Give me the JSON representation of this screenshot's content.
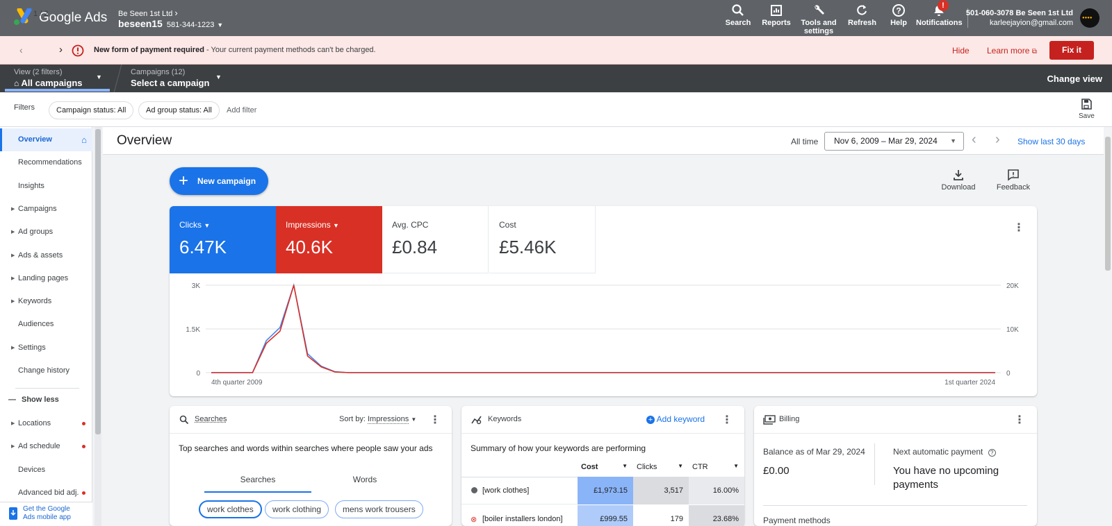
{
  "app": {
    "brand": "Google Ads",
    "account_parent": "Be Seen 1st Ltd",
    "account_name": "beseen15",
    "account_id": "581-344-1223"
  },
  "topnav": {
    "search": "Search",
    "reports": "Reports",
    "tools_line1": "Tools and",
    "tools_line2": "settings",
    "refresh": "Refresh",
    "help": "Help",
    "notifications": "Notifications",
    "notif_badge": "!",
    "user_account": "501-060-3078 Be Seen 1st Ltd",
    "user_email": "karleejayion@gmail.com"
  },
  "alert": {
    "pager": "1 / 2",
    "title": "New form of payment required",
    "message": " - Your current payment methods can't be charged.",
    "hide": "Hide",
    "learn_more": "Learn more",
    "fix_it": "Fix it"
  },
  "viewbar": {
    "view_sub": "View (2 filters)",
    "view_main": "All campaigns",
    "campaigns_sub": "Campaigns (12)",
    "campaigns_main": "Select a campaign",
    "change_view": "Change view"
  },
  "filters": {
    "label": "Filters",
    "chip1": "Campaign status: All",
    "chip2": "Ad group status: All",
    "add": "Add filter",
    "save": "Save"
  },
  "sidebar": {
    "items": [
      {
        "label": "Overview",
        "active": true
      },
      {
        "label": "Recommendations"
      },
      {
        "label": "Insights"
      },
      {
        "label": "Campaigns",
        "arrow": true
      },
      {
        "label": "Ad groups",
        "arrow": true
      },
      {
        "label": "Ads & assets",
        "arrow": true
      },
      {
        "label": "Landing pages",
        "arrow": true
      },
      {
        "label": "Keywords",
        "arrow": true
      },
      {
        "label": "Audiences"
      },
      {
        "label": "Settings",
        "arrow": true
      },
      {
        "label": "Change history"
      }
    ],
    "show_less": "Show less",
    "items2": [
      {
        "label": "Locations",
        "arrow": true,
        "dot": true
      },
      {
        "label": "Ad schedule",
        "arrow": true,
        "dot": true
      },
      {
        "label": "Devices"
      },
      {
        "label": "Advanced bid adj.",
        "dot": true
      }
    ],
    "app_line1": "Get the Google",
    "app_line2": "Ads mobile app"
  },
  "overview": {
    "title": "Overview",
    "range_label": "All time",
    "date_range": "Nov 6, 2009 – Mar 29, 2024",
    "show_last": "Show last 30 days",
    "new_campaign": "New campaign",
    "download": "Download",
    "feedback": "Feedback"
  },
  "metrics": [
    {
      "label": "Clicks",
      "value": "6.47K",
      "color": "#1a73e8"
    },
    {
      "label": "Impressions",
      "value": "40.6K",
      "color": "#d93025"
    },
    {
      "label": "Avg. CPC",
      "value": "£0.84"
    },
    {
      "label": "Cost",
      "value": "£5.46K"
    }
  ],
  "chart_data": {
    "type": "line",
    "x_start_label": "4th quarter 2009",
    "x_end_label": "1st quarter 2024",
    "y_left_ticks": [
      "3K",
      "1.5K",
      "0"
    ],
    "y_right_ticks": [
      "20K",
      "10K",
      "0"
    ],
    "y_left_range": [
      0,
      3000
    ],
    "y_right_range": [
      0,
      20000
    ],
    "n_points": 58,
    "series": [
      {
        "name": "Clicks",
        "axis": "left",
        "color": "#4285f4",
        "values": [
          0,
          0,
          0,
          0,
          1100,
          1550,
          3000,
          650,
          220,
          30,
          0,
          0,
          0,
          0,
          0,
          0,
          0,
          0,
          0,
          0,
          0,
          0,
          0,
          0,
          0,
          0,
          0,
          0,
          0,
          0,
          0,
          0,
          0,
          0,
          0,
          0,
          0,
          0,
          0,
          0,
          0,
          0,
          0,
          0,
          0,
          0,
          0,
          0,
          0,
          0,
          0,
          0,
          0,
          0,
          0,
          0,
          0,
          0
        ]
      },
      {
        "name": "Impressions",
        "axis": "right",
        "color": "#d93025",
        "values": [
          0,
          0,
          0,
          0,
          6700,
          9500,
          20000,
          3800,
          1300,
          150,
          0,
          0,
          0,
          0,
          0,
          0,
          0,
          0,
          0,
          0,
          0,
          0,
          0,
          0,
          0,
          0,
          0,
          0,
          0,
          0,
          0,
          0,
          0,
          0,
          0,
          0,
          0,
          0,
          0,
          0,
          0,
          0,
          0,
          0,
          0,
          0,
          0,
          0,
          0,
          0,
          0,
          0,
          0,
          0,
          0,
          0,
          0,
          0
        ]
      }
    ]
  },
  "searches_card": {
    "title": "Searches",
    "sort_label": "Sort by:",
    "sort_value": "Impressions",
    "description": "Top searches and words within searches where people saw your ads",
    "tab_searches": "Searches",
    "tab_words": "Words",
    "pills": [
      "work clothes",
      "work clothing",
      "mens work trousers"
    ]
  },
  "keywords_card": {
    "title": "Keywords",
    "add": "Add keyword",
    "summary": "Summary of how your keywords are performing",
    "col_cost": "Cost",
    "col_clicks": "Clicks",
    "col_ctr": "CTR",
    "rows": [
      {
        "keyword": "[work clothes]",
        "cost": "£1,973.15",
        "clicks": "3,517",
        "ctr": "16.00%"
      },
      {
        "keyword": "[boiler installers london]",
        "cost": "£999.55",
        "clicks": "179",
        "ctr": "23.68%"
      }
    ]
  },
  "billing_card": {
    "title": "Billing",
    "balance_label": "Balance as of Mar 29, 2024",
    "balance_value": "£0.00",
    "next_label": "Next automatic payment",
    "next_value": "You have no upcoming payments",
    "payment_methods": "Payment methods"
  }
}
